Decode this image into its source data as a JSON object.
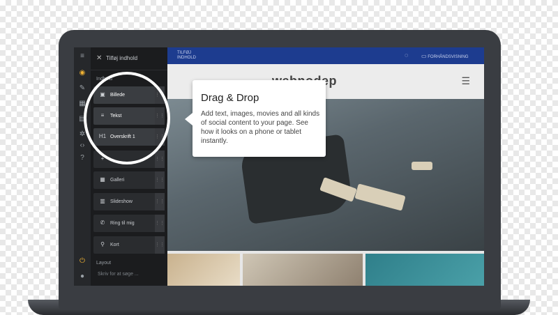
{
  "sidebar": {
    "close_icon": "close-icon",
    "title": "Tilføj indhold",
    "section_content": "Indhold",
    "items": [
      {
        "label": "Billede",
        "icon": "image-icon"
      },
      {
        "label": "Tekst",
        "icon": "text-icon"
      },
      {
        "label": "Overskrift 1",
        "icon": "heading-icon"
      },
      {
        "label": "",
        "icon": "plus-icon"
      },
      {
        "label": "Galleri",
        "icon": "gallery-icon"
      },
      {
        "label": "Slideshow",
        "icon": "slideshow-icon"
      },
      {
        "label": "Ring til mig",
        "icon": "phone-icon"
      },
      {
        "label": "Kort",
        "icon": "map-pin-icon"
      }
    ],
    "section_layout": "Layout",
    "search_placeholder": "Skriv for at søge ..."
  },
  "topbar": {
    "add_content": "TILFØJ INDHOLD",
    "preview": "FORHÅNDSVISNING"
  },
  "site": {
    "logo": "webnodep"
  },
  "tooltip": {
    "title": "Drag & Drop",
    "body": "Add text, images, movies and all kinds of social content to your page. See how it looks on a phone or tablet instantly."
  },
  "colors": {
    "accent": "#f0b233",
    "topbar": "#1d3c8f",
    "panel": "#1b1c1e"
  }
}
